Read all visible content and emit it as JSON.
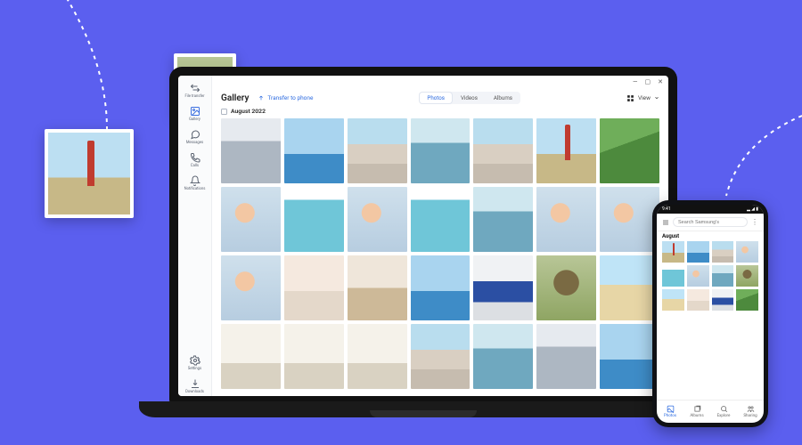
{
  "background": {
    "color": "#5b5fef"
  },
  "floating": [
    {
      "name": "lighthouse-card",
      "style": "light"
    },
    {
      "name": "cat-card",
      "style": "cat"
    }
  ],
  "laptop": {
    "app": {
      "titlebar": {
        "min": "—",
        "max": "▢",
        "close": "✕"
      },
      "sidebar": {
        "items": [
          {
            "id": "filetransfer",
            "label": "File transfer",
            "icon": "swap"
          },
          {
            "id": "gallery",
            "label": "Gallery",
            "icon": "gallery",
            "active": true
          },
          {
            "id": "messages",
            "label": "Messages",
            "icon": "chat"
          },
          {
            "id": "calls",
            "label": "Calls",
            "icon": "phone"
          },
          {
            "id": "notifications",
            "label": "Notifications",
            "icon": "bell"
          }
        ],
        "footer": [
          {
            "id": "settings",
            "label": "Settings",
            "icon": "gear"
          },
          {
            "id": "downloads",
            "label": "Downloads",
            "icon": "download"
          }
        ]
      },
      "header": {
        "title": "Gallery",
        "transfer_label": "Transfer to phone",
        "tabs": [
          {
            "id": "photos",
            "label": "Photos",
            "active": true
          },
          {
            "id": "videos",
            "label": "Videos"
          },
          {
            "id": "albums",
            "label": "Albums"
          }
        ],
        "view_label": "View"
      },
      "section": {
        "month_label": "August 2022"
      },
      "photos": [
        {
          "s": "street"
        },
        {
          "s": "sky"
        },
        {
          "s": "town"
        },
        {
          "s": "boats"
        },
        {
          "s": "town"
        },
        {
          "s": "light"
        },
        {
          "s": "green"
        },
        {
          "s": "people"
        },
        {
          "s": "pool"
        },
        {
          "s": "people"
        },
        {
          "s": "pool"
        },
        {
          "s": "boats"
        },
        {
          "s": "people"
        },
        {
          "s": "people"
        },
        {
          "s": "people"
        },
        {
          "s": "child"
        },
        {
          "s": "donkey"
        },
        {
          "s": "sky"
        },
        {
          "s": "cafe"
        },
        {
          "s": "cat"
        },
        {
          "s": "beach"
        },
        {
          "s": "arch"
        },
        {
          "s": "arch"
        },
        {
          "s": "arch"
        },
        {
          "s": "town"
        },
        {
          "s": "boats"
        },
        {
          "s": "street"
        },
        {
          "s": "sky"
        }
      ]
    }
  },
  "phone": {
    "status": {
      "time": "9:41"
    },
    "search": {
      "placeholder": "Search Samsung's"
    },
    "month_label": "August",
    "photos": [
      {
        "s": "light"
      },
      {
        "s": "sky"
      },
      {
        "s": "town"
      },
      {
        "s": "people"
      },
      {
        "s": "pool"
      },
      {
        "s": "people"
      },
      {
        "s": "boats"
      },
      {
        "s": "cat"
      },
      {
        "s": "beach"
      },
      {
        "s": "child"
      },
      {
        "s": "cafe"
      },
      {
        "s": "green"
      }
    ],
    "nav": [
      {
        "id": "photos",
        "label": "Photos",
        "active": true
      },
      {
        "id": "albums",
        "label": "Albums"
      },
      {
        "id": "explore",
        "label": "Explore"
      },
      {
        "id": "sharing",
        "label": "Sharing"
      }
    ]
  }
}
